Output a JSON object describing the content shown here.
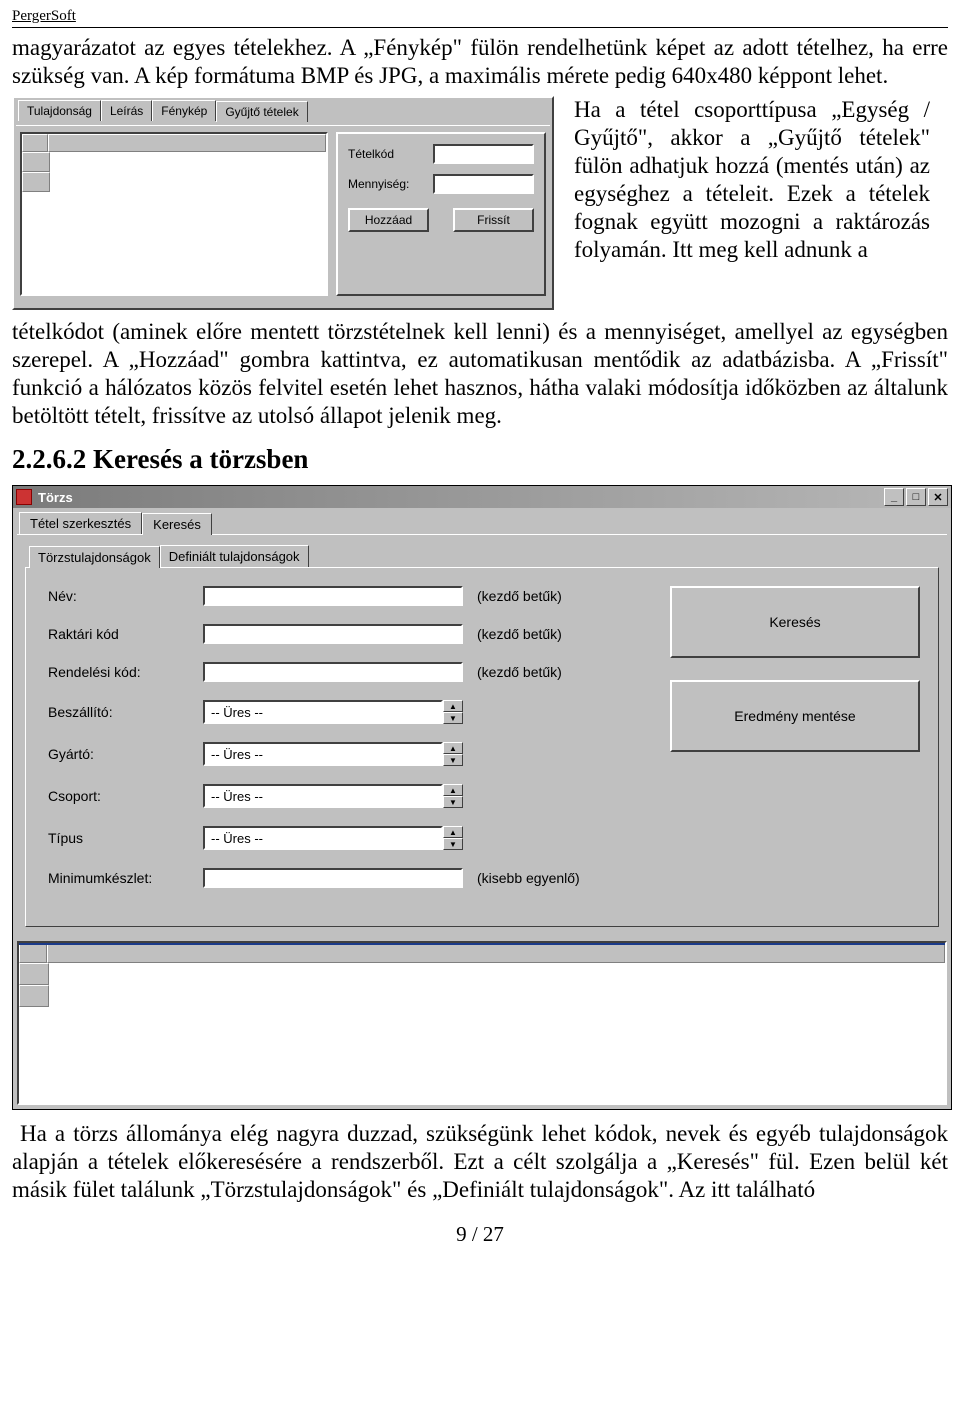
{
  "header": {
    "brand": "PergerSoft"
  },
  "para1": "magyarázatot az egyes tételekhez. A „Fénykép\" fülön rendelhetünk képet az adott tételhez, ha erre szükség van. A kép formátuma BMP és JPG, a maximális mérete pedig 640x480 képpont lehet.",
  "panel1": {
    "tabs": [
      "Tulajdonság",
      "Leírás",
      "Fénykép",
      "Gyűjtő tételek"
    ],
    "activeTab": 3,
    "labels": {
      "code": "Tételkód",
      "qty": "Mennyiség:"
    },
    "buttons": {
      "add": "Hozzáad",
      "refresh": "Frissít"
    }
  },
  "rtext1a": "Ha a tétel csoporttípusa „Egység / Gyűjtő\", akkor a „Gyűjtő tételek\" fülön adhatjuk hozzá (mentés után) az egységhez a tételeit. Ezek a tételek fognak együtt mozogni a raktározás folyamán. Itt meg kell adnunk a",
  "para2": "tételkódot (aminek előre mentett törzstételnek kell lenni) és a mennyiséget, amellyel az egységben szerepel. A „Hozzáad\" gombra kattintva, ez automatikusan mentődik az adatbázisba. A „Frissít\" funkció a hálózatos közös felvitel esetén lehet hasznos, hátha valaki módosítja időközben az általunk betöltött tételt, frissítve az utolsó állapot jelenik meg.",
  "h2": "2.2.6.2 Keresés a törzsben",
  "panel2": {
    "title": "Törzs",
    "outerTabs": [
      "Tétel szerkesztés",
      "Keresés"
    ],
    "outerActive": 1,
    "innerTabs": [
      "Törzstulajdonságok",
      "Definiált tulajdonságok"
    ],
    "innerActive": 0,
    "rows": [
      {
        "label": "Név:",
        "type": "text",
        "hint": "(kezdő betűk)"
      },
      {
        "label": "Raktári kód",
        "type": "text",
        "hint": "(kezdő betűk)"
      },
      {
        "label": "Rendelési kód:",
        "type": "text",
        "hint": "(kezdő betűk)"
      },
      {
        "label": "Beszállító:",
        "type": "combo",
        "value": "-- Üres --"
      },
      {
        "label": "Gyártó:",
        "type": "combo",
        "value": "-- Üres --"
      },
      {
        "label": "Csoport:",
        "type": "combo",
        "value": "-- Üres --"
      },
      {
        "label": "Típus",
        "type": "combo",
        "value": "-- Üres --"
      },
      {
        "label": "Minimumkészlet:",
        "type": "text",
        "hint": "(kisebb egyenlő)"
      }
    ],
    "buttons": {
      "search": "Keresés",
      "save": "Eredmény mentése"
    }
  },
  "para3": "Ha a törzs állománya elég nagyra duzzad, szükségünk lehet kódok, nevek és egyéb tulajdonságok alapján a tételek előkeresésére a rendszerből. Ezt a célt szolgálja a „Keresés\" fül. Ezen belül két másik  fület  találunk  „Törzstulajdonságok\"  és  „Definiált  tulajdonságok\".  Az  itt  található",
  "footer": "9 / 27"
}
